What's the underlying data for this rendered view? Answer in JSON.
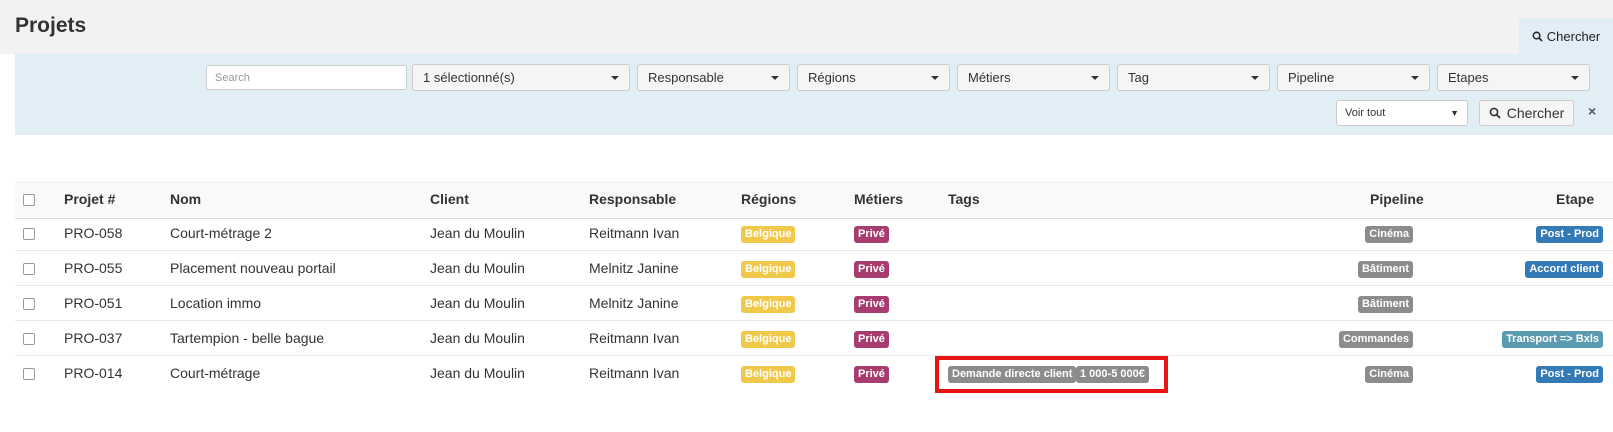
{
  "page": {
    "title": "Projets"
  },
  "header": {
    "search_tab_label": "Chercher"
  },
  "filters": {
    "search_placeholder": "Search",
    "dropdowns": [
      {
        "label": "1 sélectionné(s)"
      },
      {
        "label": "Responsable"
      },
      {
        "label": "Régions"
      },
      {
        "label": "Métiers"
      },
      {
        "label": "Tag"
      },
      {
        "label": "Pipeline"
      },
      {
        "label": "Etapes"
      }
    ],
    "view_select": "Voir tout",
    "search_button": "Chercher",
    "close": "×"
  },
  "table": {
    "headers": [
      "Projet #",
      "Nom",
      "Client",
      "Responsable",
      "Régions",
      "Métiers",
      "Tags",
      "Pipeline",
      "Etape"
    ],
    "rows": [
      {
        "id": "PRO-058",
        "name": "Court-métrage 2",
        "client": "Jean du Moulin",
        "owner": "Reitmann Ivan",
        "region": "Belgique",
        "metier": "Privé",
        "tags": [],
        "pipeline": "Cinéma",
        "etape": "Post - Prod"
      },
      {
        "id": "PRO-055",
        "name": "Placement nouveau portail",
        "client": "Jean du Moulin",
        "owner": "Melnitz Janine",
        "region": "Belgique",
        "metier": "Privé",
        "tags": [],
        "pipeline": "Bâtiment",
        "etape": "Accord client"
      },
      {
        "id": "PRO-051",
        "name": "Location immo",
        "client": "Jean du Moulin",
        "owner": "Melnitz Janine",
        "region": "Belgique",
        "metier": "Privé",
        "tags": [],
        "pipeline": "Bâtiment",
        "etape": ""
      },
      {
        "id": "PRO-037",
        "name": "Tartempion - belle bague",
        "client": "Jean du Moulin",
        "owner": "Reitmann Ivan",
        "region": "Belgique",
        "metier": "Privé",
        "tags": [],
        "pipeline": "Commandes",
        "etape": "Transport => Bxls"
      },
      {
        "id": "PRO-014",
        "name": "Court-métrage",
        "client": "Jean du Moulin",
        "owner": "Reitmann Ivan",
        "region": "Belgique",
        "metier": "Privé",
        "tags": [
          "Demande directe client",
          "1 000-5 000€"
        ],
        "pipeline": "Cinéma",
        "etape": "Post - Prod"
      }
    ]
  },
  "colors": {
    "region_badge": "#f0c94b",
    "metier_badge": "#a63d6e",
    "pipeline_badge": "#8c8c8c",
    "tag_badge": "#8c8c8c",
    "etape_blue": "#337ab7",
    "etape_teal": "#5b9ab0",
    "highlight": "#e81416"
  }
}
